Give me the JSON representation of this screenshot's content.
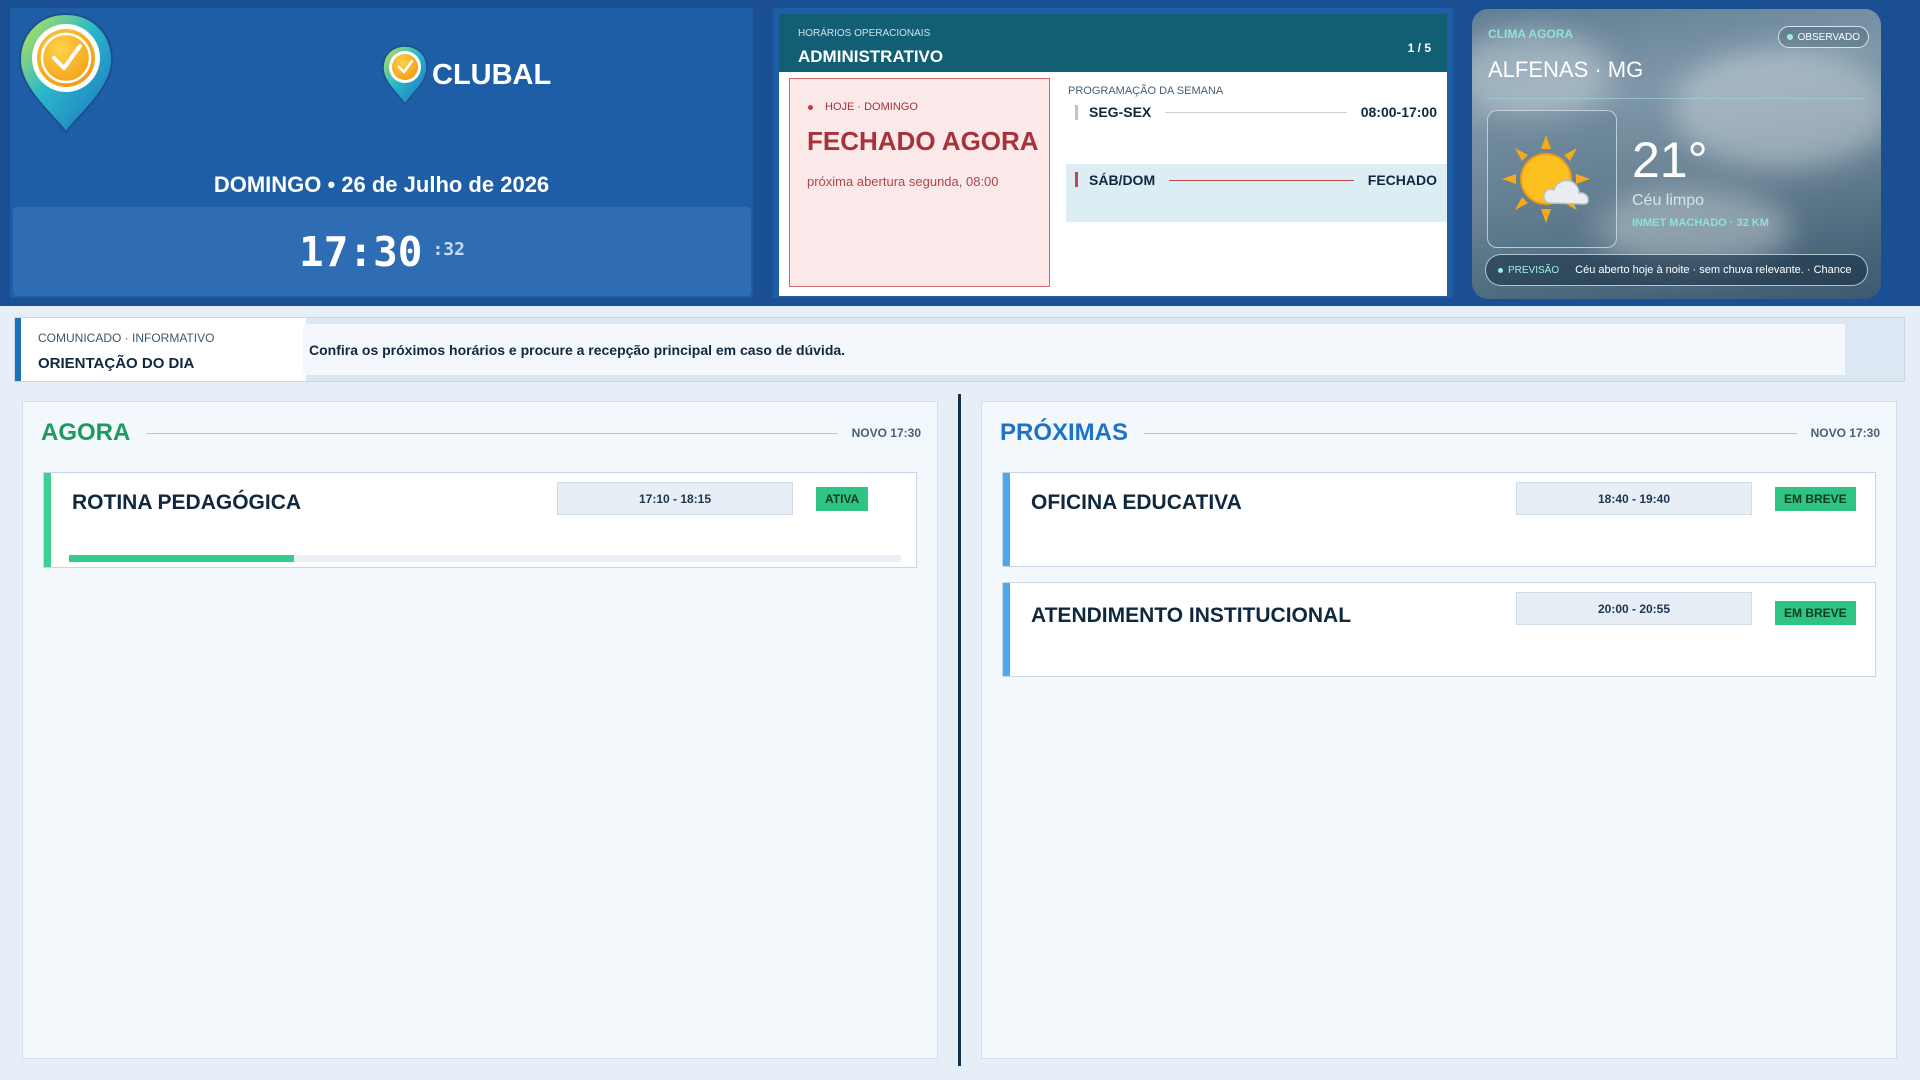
{
  "header": {
    "brand": "CLUBAL",
    "date_line": "DOMINGO • 26 de Julho de 2026",
    "clock": {
      "hm": "17:30",
      "seconds": ":32"
    }
  },
  "hours": {
    "kicker": "HORÁRIOS OPERACIONAIS",
    "title": "ADMINISTRATIVO",
    "pager": "1 / 5",
    "today": {
      "kicker": "HOJE · DOMINGO",
      "status": "FECHADO AGORA",
      "next_opening": "próxima abertura segunda, 08:00"
    },
    "week_label": "PROGRAMAÇÃO DA SEMANA",
    "week": [
      {
        "day": "SEG-SEX",
        "time": "08:00-17:00"
      },
      {
        "day": "SÁB/DOM",
        "time": "FECHADO"
      }
    ]
  },
  "weather": {
    "kicker": "CLIMA AGORA",
    "badge": "OBSERVADO",
    "city": "ALFENAS · MG",
    "temperature": "21°",
    "condition": "Céu limpo",
    "source": "INMET MACHADO · 32 KM",
    "forecast_label": "PREVISÃO",
    "forecast_text": "Céu aberto hoje à noite · sem chuva relevante. · Chance",
    "icon": "sun-cloud-icon"
  },
  "notice": {
    "kicker": "COMUNICADO · INFORMATIVO",
    "title": "ORIENTAÇÃO DO DIA",
    "message": "Confira os próximos horários e procure a recepção principal em caso de dúvida."
  },
  "now": {
    "title": "AGORA",
    "stamp": "NOVO 17:30",
    "events": [
      {
        "title": "ROTINA PEDAGÓGICA",
        "time": "17:10 - 18:15",
        "badge": "ATIVA",
        "progress": 0.27
      }
    ]
  },
  "next": {
    "title": "PRÓXIMAS",
    "stamp": "NOVO 17:30",
    "events": [
      {
        "title": "OFICINA EDUCATIVA",
        "time": "18:40 - 19:40",
        "badge": "EM BREVE"
      },
      {
        "title": "ATENDIMENTO INSTITUCIONAL",
        "time": "20:00 - 20:55",
        "badge": "EM BREVE"
      }
    ]
  },
  "colors": {
    "header_band": "#1b4f94",
    "panel": "#1e5ea6",
    "hours_head": "#125e73",
    "closed_red": "#a8323a",
    "now_green": "#1f9a5e",
    "next_blue": "#1d73c8",
    "badge_green": "#2fc484"
  }
}
